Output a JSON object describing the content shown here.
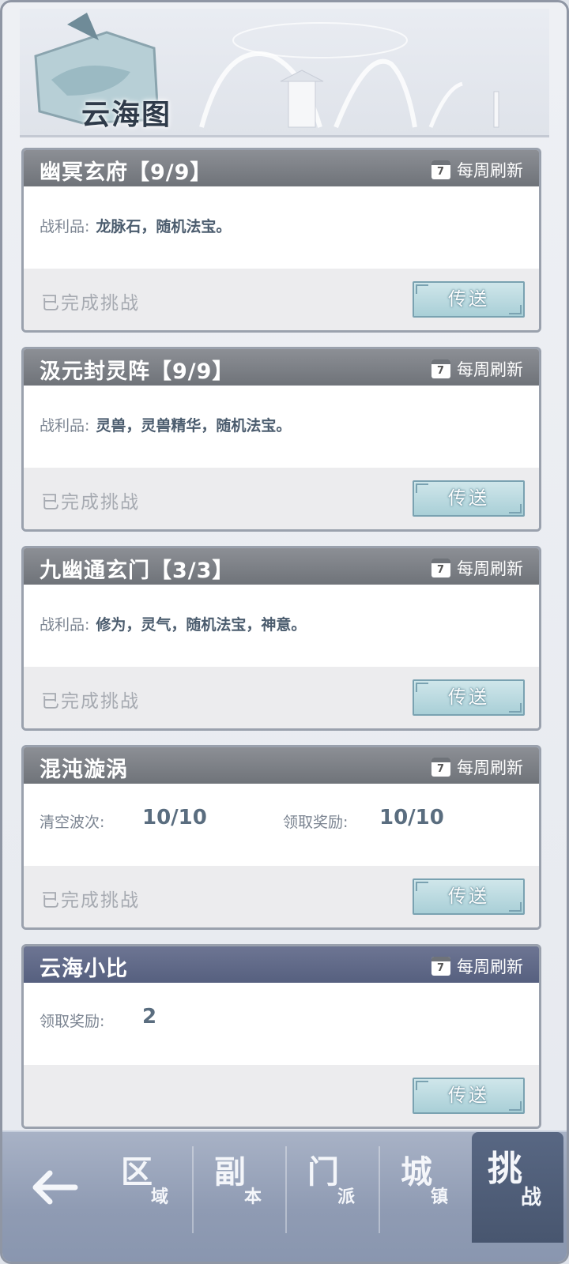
{
  "header": {
    "title": "云海图"
  },
  "cards": [
    {
      "title": "幽冥玄府【9/9】",
      "refresh_label": "每周刷新",
      "calendar_day": "7",
      "loot_label": "战利品:",
      "loot_value": "龙脉石，随机法宝。",
      "status": "已完成挑战",
      "button": "传送"
    },
    {
      "title": "汲元封灵阵【9/9】",
      "refresh_label": "每周刷新",
      "calendar_day": "7",
      "loot_label": "战利品:",
      "loot_value": "灵兽，灵兽精华，随机法宝。",
      "status": "已完成挑战",
      "button": "传送"
    },
    {
      "title": "九幽通玄门【3/3】",
      "refresh_label": "每周刷新",
      "calendar_day": "7",
      "loot_label": "战利品:",
      "loot_value": "修为，灵气，随机法宝，神意。",
      "status": "已完成挑战",
      "button": "传送"
    },
    {
      "title": "混沌漩涡",
      "refresh_label": "每周刷新",
      "calendar_day": "7",
      "stat1_label": "清空波次:",
      "stat1_value": "10/10",
      "stat2_label": "领取奖励:",
      "stat2_value": "10/10",
      "status": "已完成挑战",
      "button": "传送"
    },
    {
      "title": "云海小比",
      "refresh_label": "每周刷新",
      "calendar_day": "7",
      "stat1_label": "领取奖励:",
      "stat1_value": "2",
      "status": "",
      "button": "传送"
    }
  ],
  "nav": {
    "items": [
      {
        "big": "区",
        "small": "域"
      },
      {
        "big": "副",
        "small": "本"
      },
      {
        "big": "门",
        "small": "派"
      },
      {
        "big": "城",
        "small": "镇"
      },
      {
        "big": "挑",
        "small": "战"
      }
    ],
    "active_index": 4
  },
  "colors": {
    "card_header": "#7b7f85",
    "card_header_active": "#5f6888",
    "button": "#b8dbe1",
    "nav_bg": "#97a3b9"
  }
}
